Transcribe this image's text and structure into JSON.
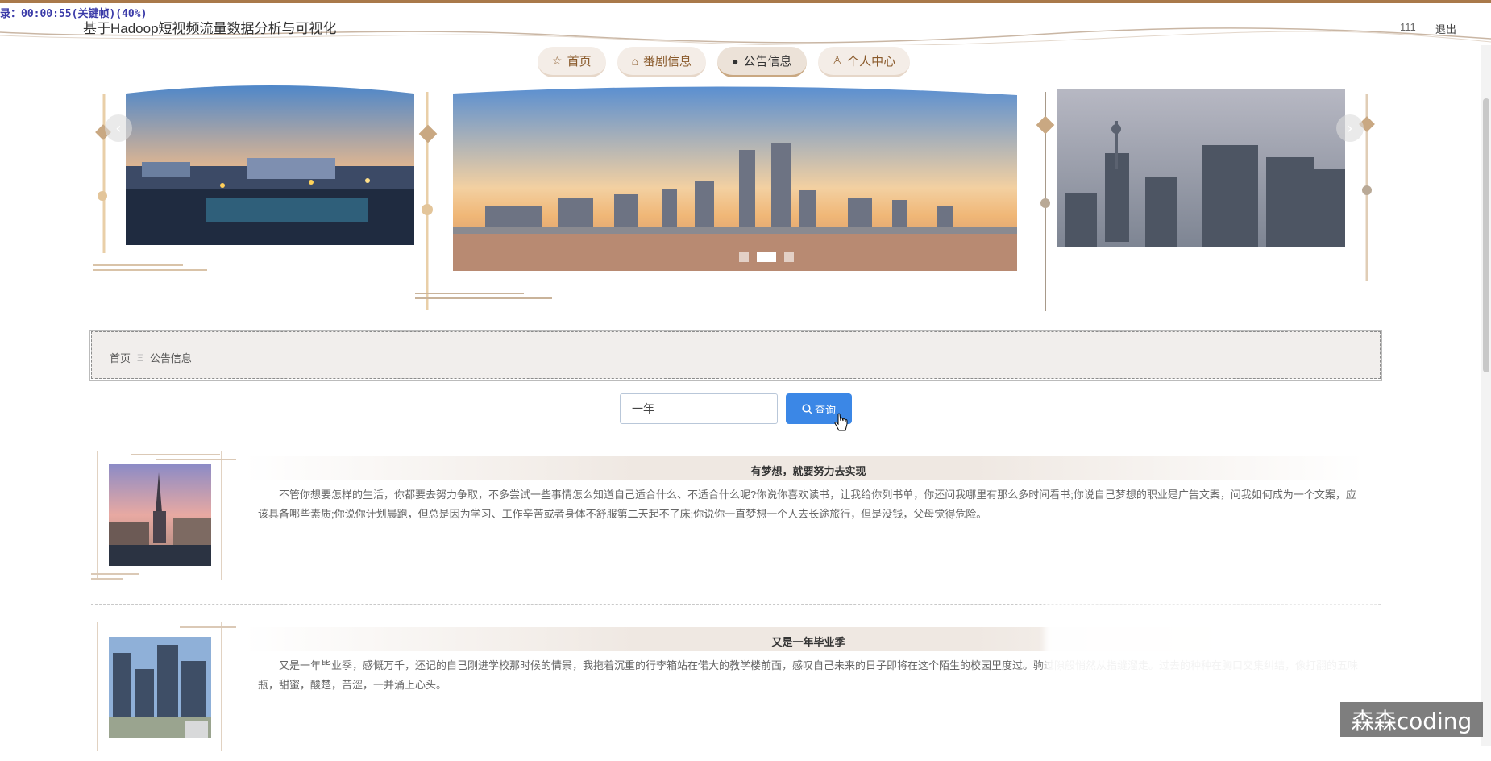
{
  "recording_overlay": "录：00:00:55(关键帧)(40%)",
  "header": {
    "title": "基于Hadoop短视频流量数据分析与可视化",
    "username": "111",
    "logout_label": "退出"
  },
  "nav": {
    "items": [
      {
        "label": "首页",
        "icon": "star-icon",
        "active": false
      },
      {
        "label": "番剧信息",
        "icon": "bag-icon",
        "active": false
      },
      {
        "label": "公告信息",
        "icon": "info-icon",
        "active": true
      },
      {
        "label": "个人中心",
        "icon": "user-icon",
        "active": false
      }
    ]
  },
  "carousel": {
    "slide_count": 3,
    "active_index": 1
  },
  "breadcrumb": {
    "home": "首页",
    "separator": "Ξ",
    "current": "公告信息"
  },
  "search": {
    "value": "一年",
    "button_label": "查询"
  },
  "news": [
    {
      "title": "有梦想，就要努力去实现",
      "body": "不管你想要怎样的生活，你都要去努力争取，不多尝试一些事情怎么知道自己适合什么、不适合什么呢?你说你喜欢读书，让我给你列书单，你还问我哪里有那么多时间看书;你说自己梦想的职业是广告文案，问我如何成为一个文案，应该具备哪些素质;你说你计划晨跑，但总是因为学习、工作辛苦或者身体不舒服第二天起不了床;你说你一直梦想一个人去长途旅行，但是没钱，父母觉得危险。"
    },
    {
      "title": "又是一年毕业季",
      "body": "又是一年毕业季，感慨万千，还记的自己刚进学校那时候的情景，我拖着沉重的行李箱站在偌大的教学楼前面，感叹自己未来的日子即将在这个陌生的校园里度过。驹过隙般悄然从指缝溜走。过去的种种在胸口交集纠结，像打翻的五味瓶，甜蜜，酸楚，苦涩，一并涌上心头。"
    }
  ],
  "watermark": "森森coding",
  "colors": {
    "accent_brown": "#a9794a",
    "search_button": "#3b87e6",
    "nav_bg": "#f4ede7"
  }
}
